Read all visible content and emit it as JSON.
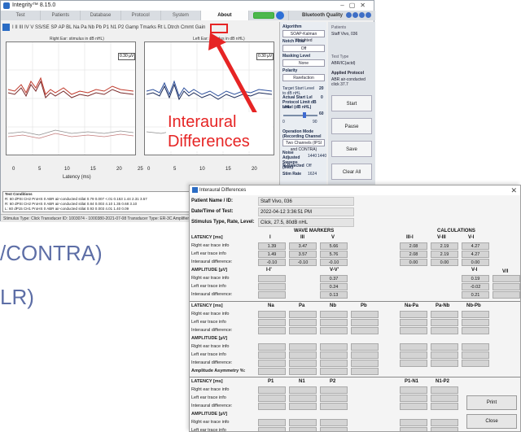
{
  "window": {
    "title": "Integrity™ 8.15.0",
    "tabs": [
      "Test",
      "Patients",
      "Database",
      "Protocol",
      "System",
      "About",
      "Exit"
    ],
    "active_tab": "About",
    "bluetooth_label": "Bluetooth Quality",
    "toolbar_text": "I  II  III IV  V  SS/SE  SP  AP  BL  Na  Pa  Nb  Pb  P1  N1  P2     Gamp   Tmarks   Rt  L  Dtrch   Cmmt  Gain",
    "toolbar_zoom": "None",
    "toolbar_gain": "36"
  },
  "plots": {
    "right": {
      "caption": "Right Ear: stimulus in dB nHL)",
      "gain": "0.30 µV"
    },
    "left": {
      "caption": "Left Ear: stimulus in dB nHL)",
      "gain": "0.30 µV"
    },
    "x_ticks": [
      "0",
      "5",
      "10",
      "15",
      "20",
      "25",
      "0",
      "5",
      "10",
      "15",
      "20"
    ],
    "x_label": "Latency (ms)"
  },
  "conditions_table": {
    "header": "Test Conditions",
    "rows": [
      "R: 60 dPSt CH2  ProHS 0  ABR air-conducted stilat   0.79   0.007   <.01   0.153  1.44   2.31   3.57",
      "R: 60 dPSt CH2  ProHS 0  ABR air-conducted stilat   0.84   0.003   4.10   1.35   0.68   3.10",
      "L: 60 dP15 CH1  ProHS 0  ABR air-conducted stilat   0.93   0.003   4.01   1.40   0.09"
    ]
  },
  "status_bar": "Stimulus Type: Click  Transducer ID: 1003074 - 1000380-2021-07-08  Transducer Type: ER-3C  Amplifier ID: AV1219-2021-09-09",
  "side_panel": {
    "algorithm_label": "Algorithm",
    "algorithm_value": "SOAP-Kalman Weighted",
    "notch_label": "Notch Filter",
    "notch_value": "Off",
    "masking_label": "Masking Level",
    "masking_value": "None",
    "polarity_label": "Polarity",
    "polarity_value": "Rarefaction",
    "target_label": "Target Start Level to dB nHL",
    "target_value": "20",
    "actual_label": "Actual Start Lvl Protocol Limit dB nHL",
    "actual_value": "0",
    "level_label": "Level (dB nHL)",
    "level_value": "60",
    "level_min": "0",
    "level_max": "90",
    "mode_label": "Operation Mode (Recording Channel Selection)",
    "mode_value": "Two Channels (IPSI and CONTRA)",
    "noise_label": "Noise Adjusted Sweeps (Max)",
    "noise_v1": "1440",
    "noise_v2": "1440",
    "reject_label": "% Rejected",
    "reject_value": "Off",
    "stim_label": "Stim Rate",
    "stim_value": "1624"
  },
  "right_panel": {
    "patient_label": "Patients",
    "patient_value": "Staff Vivo, 036",
    "test_type_label": "Test Type",
    "test_type_value": "ABR/IC(actd)",
    "protocol_label": "Applied Protocol",
    "protocol_value": "ABR air-conducted click 37.7",
    "buttons": [
      "Start",
      "Pause",
      "Save",
      "Clear All"
    ]
  },
  "annotation": {
    "callout_line1": "Interaural",
    "callout_line2": "Differences",
    "bg_text1": "/CONTRA)",
    "bg_text2": "LR)",
    "accent_color": "#e62424"
  },
  "dialog": {
    "title": "Interaural Differences",
    "patient_label": "Patient Name / ID:",
    "patient_value": "Staff Vivo, 036",
    "date_label": "Date/Time of Test:",
    "date_value": "2022-04-12 3:36:51 PM",
    "stim_label": "Stimulus Type, Rate, Level:",
    "stim_value": "Click, 27.5, 80dB nHL",
    "wave_markers_header": "WAVE MARKERS",
    "calculations_header": "CALCULATIONS",
    "section1": {
      "latency_label": "LATENCY [ms]",
      "cols_left": [
        "I",
        "III",
        "V"
      ],
      "cols_right": [
        "III-I",
        "V-III",
        "V-I"
      ],
      "rows": [
        {
          "label": "Right ear trace info",
          "left": [
            "1.39",
            "3.47",
            "5.66"
          ],
          "right": [
            "2.08",
            "2.19",
            "4.27"
          ]
        },
        {
          "label": "Left ear trace info",
          "left": [
            "1.49",
            "3.57",
            "5.76"
          ],
          "right": [
            "2.08",
            "2.19",
            "4.27"
          ]
        },
        {
          "label": "Interaural difference:",
          "left": [
            "-0.10",
            "-0.10",
            "-0.10"
          ],
          "right": [
            "0.00",
            "0.00",
            "0.00"
          ]
        }
      ],
      "amp_label": "AMPLITUDE [µV]",
      "amp_cols_left": [
        "I-I'",
        "",
        "V-V'"
      ],
      "amp_cols_right": [
        "",
        "",
        "V-I",
        "V/I"
      ],
      "amp_rows": [
        {
          "label": "Right ear trace info",
          "v": "0.37",
          "vi": "0.19"
        },
        {
          "label": "Left ear trace info",
          "v": "0.24",
          "vi": "-0.02"
        },
        {
          "label": "Interaural difference:",
          "v": "0.13",
          "vi": "0.21"
        }
      ]
    },
    "section2": {
      "latency_label": "LATENCY [ms]",
      "cols_left": [
        "Na",
        "Pa",
        "Nb",
        "Pb"
      ],
      "cols_right": [
        "Na-Pa",
        "Pa-Nb",
        "Nb-Pb"
      ],
      "row_labels": [
        "Right ear trace info",
        "Left ear trace info",
        "Interaural difference:"
      ],
      "amp_label": "AMPLITUDE [µV]",
      "asym_label": "Amplitude Asymmetry %:"
    },
    "section3": {
      "latency_label": "LATENCY [ms]",
      "cols_left": [
        "P1",
        "N1",
        "P2"
      ],
      "cols_right": [
        "P1-N1",
        "N1-P2"
      ],
      "row_labels": [
        "Right ear trace info",
        "Left ear trace info",
        "Interaural difference:"
      ],
      "amp_label": "AMPLITUDE [µV]",
      "asym_label": "Amplitude Asymmetry %:"
    },
    "buttons": {
      "print": "Print",
      "close": "Close"
    }
  }
}
